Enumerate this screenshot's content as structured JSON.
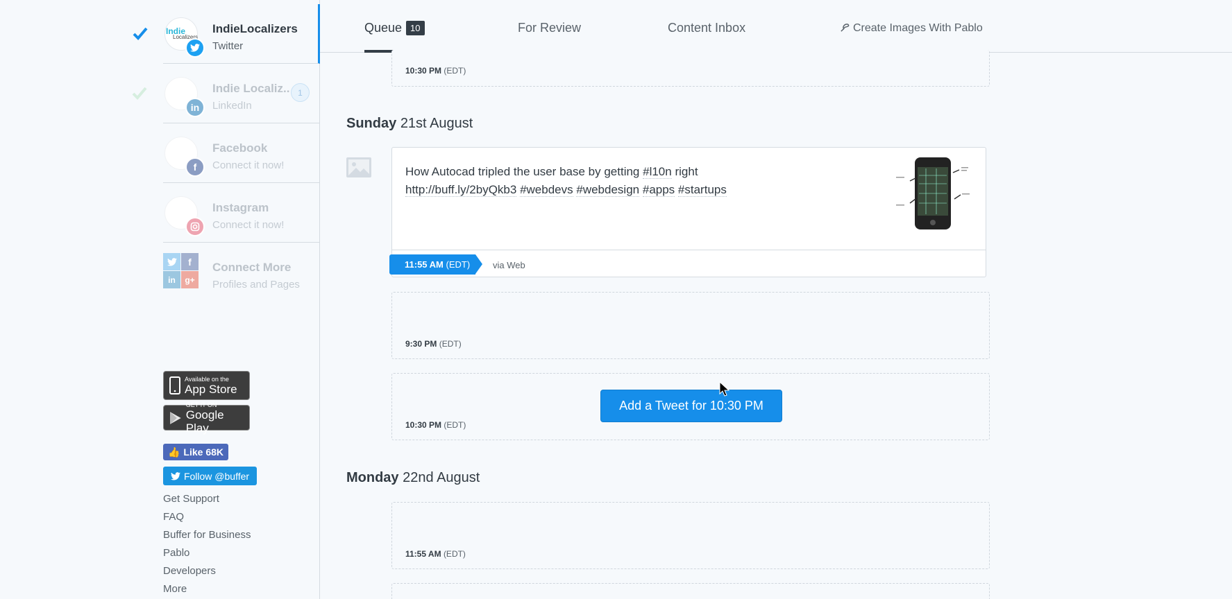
{
  "sidebar": {
    "profiles": [
      {
        "name": "IndieLocalizers",
        "network": "Twitter",
        "avatar_text_top": "Indie",
        "avatar_text_bottom": "Localizers",
        "badge_icon": "twitter-icon",
        "badge_color": "#1da1f2"
      },
      {
        "name": "Indie Localiz..",
        "network": "LinkedIn",
        "badge_icon": "linkedin-icon",
        "badge_color": "#0077b5",
        "count": "1"
      },
      {
        "name": "Facebook",
        "network": "Connect it now!",
        "badge_icon": "facebook-icon",
        "badge_color": "#3b5998"
      },
      {
        "name": "Instagram",
        "network": "Connect it now!",
        "badge_icon": "instagram-icon",
        "badge_color": "#e4405f"
      },
      {
        "name": "Connect More",
        "network": "Profiles and Pages"
      }
    ],
    "app_store": {
      "small": "Available on the",
      "big": "App Store"
    },
    "google_play": {
      "small": "GET IT ON",
      "big": "Google Play"
    },
    "like_label": "Like 68K",
    "follow_label": "Follow @buffer",
    "footer_links": [
      "Get Support",
      "FAQ",
      "Buffer for Business",
      "Pablo",
      "Developers",
      "More"
    ]
  },
  "tabs": {
    "queue": {
      "label": "Queue",
      "count": "10"
    },
    "review": {
      "label": "For Review"
    },
    "inbox": {
      "label": "Content Inbox"
    },
    "pablo": {
      "label": "Create Images With Pablo"
    }
  },
  "queue": {
    "slot_top": {
      "time": "10:30 PM",
      "zone": "(EDT)"
    },
    "day1": {
      "weekday": "Sunday",
      "date": "21st August"
    },
    "post": {
      "line1": "How Autocad tripled the user base by getting",
      "hashtag1": "#l10n",
      "line1_end": "right",
      "url": "http://buff.ly/2byQkb3",
      "hashtags": [
        "#webdevs",
        "#webdesign",
        "#apps",
        "#startups"
      ],
      "time": "11:55 AM",
      "zone": "(EDT)",
      "via": "via Web"
    },
    "slot2": {
      "time": "9:30 PM",
      "zone": "(EDT)"
    },
    "slot3": {
      "time": "10:30 PM",
      "zone": "(EDT)",
      "button": "Add a Tweet for 10:30 PM"
    },
    "day2": {
      "weekday": "Monday",
      "date": "22nd August"
    },
    "slot4": {
      "time": "11:55 AM",
      "zone": "(EDT)"
    }
  },
  "colors": {
    "accent": "#168eea",
    "dark": "#343e47"
  }
}
